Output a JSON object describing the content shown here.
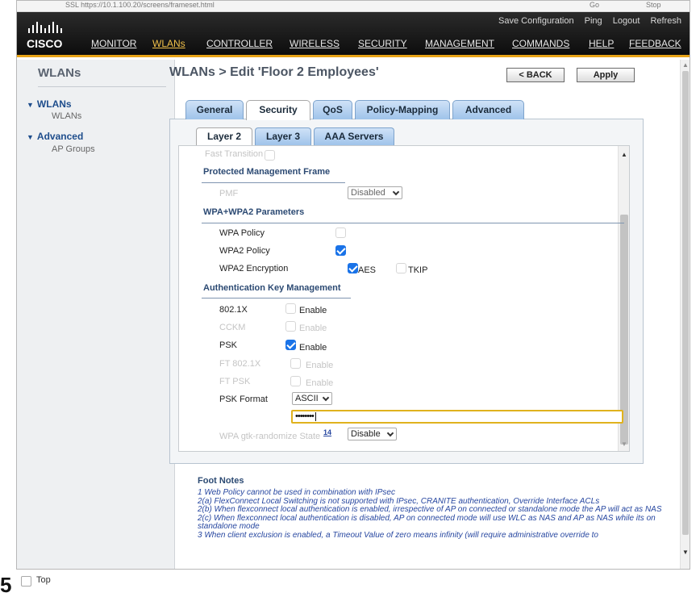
{
  "url_strip": {
    "left": "SSL  https://10.1.100.20/screens/frameset.html",
    "mid": "Go",
    "right": "Stop"
  },
  "header": {
    "logo_text": "CISCO",
    "util_links": [
      "Save Configuration",
      "Ping",
      "Logout",
      "Refresh"
    ],
    "nav": [
      "MONITOR",
      "WLANs",
      "CONTROLLER",
      "WIRELESS",
      "SECURITY",
      "MANAGEMENT",
      "COMMANDS",
      "HELP",
      "FEEDBACK"
    ],
    "accent_color": "#e8a317"
  },
  "sidebar": {
    "title": "WLANs",
    "groups": [
      {
        "label": "WLANs",
        "items": [
          "WLANs"
        ]
      },
      {
        "label": "Advanced",
        "items": [
          "AP Groups"
        ]
      }
    ]
  },
  "page": {
    "title": "WLANs > Edit  'Floor 2 Employees'",
    "back": "< BACK",
    "apply": "Apply"
  },
  "tabs": [
    "General",
    "Security",
    "QoS",
    "Policy-Mapping",
    "Advanced"
  ],
  "subtabs": [
    "Layer 2",
    "Layer 3",
    "AAA Servers"
  ],
  "security": {
    "fast_transition": "Fast Transition",
    "pmf_section": "Protected Management Frame",
    "pmf_label": "PMF",
    "pmf_value": "Disabled",
    "wpa_section": "WPA+WPA2 Parameters",
    "wpa_policy": "WPA Policy",
    "wpa2_policy": "WPA2 Policy",
    "wpa2_encryption": "WPA2 Encryption",
    "aes": "AES",
    "tkip": "TKIP",
    "akm_section": "Authentication Key Management",
    "akm": [
      {
        "name": "802.1X",
        "checked": false,
        "enabled": true
      },
      {
        "name": "CCKM",
        "checked": false,
        "enabled": false
      },
      {
        "name": "PSK",
        "checked": true,
        "enabled": true
      },
      {
        "name": "FT 802.1X",
        "checked": false,
        "enabled": false
      },
      {
        "name": "FT PSK",
        "checked": false,
        "enabled": false
      }
    ],
    "enable_label": "Enable",
    "psk_format": "PSK Format",
    "psk_format_value": "ASCII",
    "psk_value": "••••••••",
    "gtk_label": "WPA gtk-randomize State",
    "gtk_footnote": "14",
    "gtk_value": "Disable"
  },
  "footnotes": {
    "title": "Foot Notes",
    "lines": [
      "1 Web Policy cannot be used in combination with IPsec",
      "2(a) FlexConnect Local Switching is not supported with IPsec, CRANITE authentication, Override Interface ACLs",
      "2(b) When flexconnect local authentication is enabled, irrespective of AP on connected or standalone mode the AP will act as NAS",
      "2(c) When flexconnect local authentication is disabled, AP on connected mode will use WLC as NAS and AP as NAS while its on standalone mode",
      "3 When client exclusion is enabled, a Timeout Value of zero means infinity (will require administrative override to"
    ]
  },
  "bottom": {
    "number": "5",
    "top_label": "Top"
  }
}
